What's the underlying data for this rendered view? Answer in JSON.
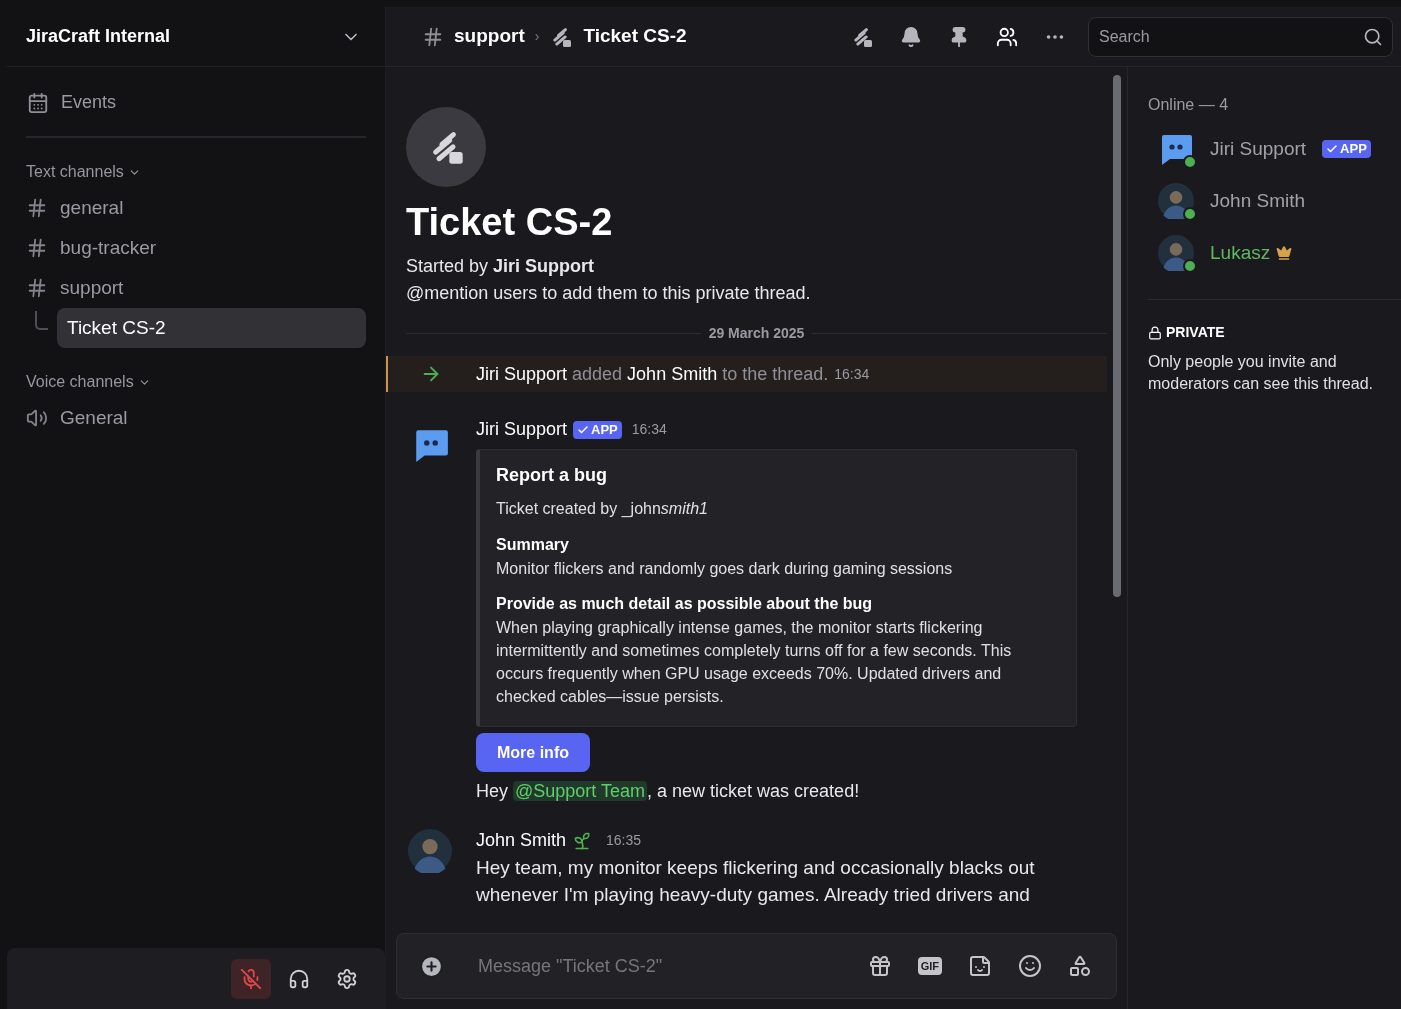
{
  "server": {
    "name": "JiraCraft Internal"
  },
  "sidebar": {
    "events_label": "Events",
    "sections": [
      {
        "title": "Text channels",
        "channels": [
          {
            "name": "general",
            "kind": "text",
            "selected": false
          },
          {
            "name": "bug-tracker",
            "kind": "text",
            "selected": false
          },
          {
            "name": "support",
            "kind": "text",
            "selected": false
          },
          {
            "name": "Ticket CS-2",
            "kind": "thread",
            "selected": true
          }
        ]
      },
      {
        "title": "Voice channels",
        "channels": [
          {
            "name": "General",
            "kind": "voice",
            "selected": false
          }
        ]
      }
    ]
  },
  "user_panel": {
    "mic_muted": true
  },
  "header": {
    "channel": "support",
    "separator": "›",
    "thread": "Ticket CS-2",
    "search_placeholder": "Search"
  },
  "thread_intro": {
    "title": "Ticket CS-2",
    "started_by": "Started by **Jiri Support**",
    "hint": "@mention users to add them to this private thread."
  },
  "date_divider": "29 March 2025",
  "system_message": {
    "actor": "Jiri Support",
    "action": "added",
    "target": "John Smith",
    "suffix": "to the thread.",
    "time": "16:34"
  },
  "messages": [
    {
      "author": "Jiri Support",
      "app_badge": "APP",
      "kind": "bot",
      "time": "16:34",
      "embed": {
        "title": "Report a bug",
        "description": "Ticket created by _john",
        "description_italic": "smith1",
        "fields": [
          {
            "name": "Summary",
            "value": "Monitor flickers and randomly goes dark during gaming sessions"
          },
          {
            "name": "Provide as much detail as possible about the bug",
            "value": "When playing graphically intense games, the monitor starts flickering intermittently and sometimes completely turns off for a few seconds. This occurs frequently when GPU usage exceeds 70%. Updated drivers and checked cables—issue persists."
          }
        ]
      },
      "button": "More info",
      "text_before": "Hey",
      "mention": "@Support Team",
      "text_after": ", a new ticket was created!"
    },
    {
      "author": "John Smith",
      "kind": "user",
      "time": "16:35",
      "badge_icon": true,
      "text": "Hey team, my monitor keeps flickering and occasionally blacks out whenever I'm playing heavy-duty games. Already tried drivers and"
    }
  ],
  "composer": {
    "placeholder": "Message \"Ticket CS-2\"",
    "gif_label": "GIF"
  },
  "members": {
    "heading": "Online — 4",
    "list": [
      {
        "name": "Jiri Support",
        "kind": "bot",
        "app_badge": "APP",
        "owner": false,
        "color": "#a1a1a9"
      },
      {
        "name": "John Smith",
        "kind": "user",
        "owner": false,
        "color": "#a1a1a9"
      },
      {
        "name": "Lukasz",
        "kind": "user",
        "owner": true,
        "color": "#5fb862"
      }
    ]
  },
  "privacy": {
    "label": "PRIVATE",
    "text": "Only people you invite and moderators can see this thread."
  }
}
